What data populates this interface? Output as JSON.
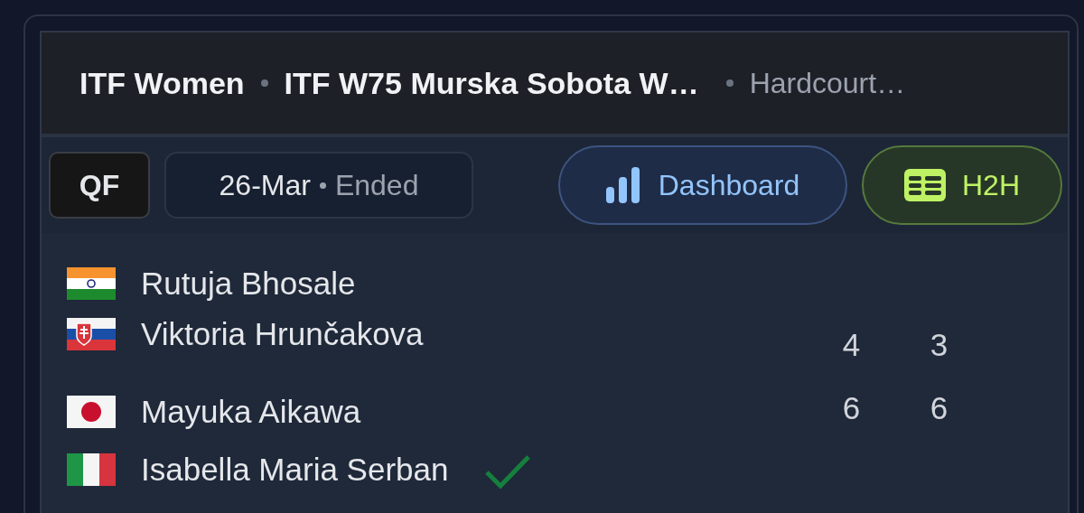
{
  "header": {
    "category": "ITF Women",
    "tournament": "ITF W75 Murska Sobota W…",
    "surface": "Hardcourt…"
  },
  "round": "QF",
  "date": "26-Mar",
  "status": "Ended",
  "buttons": [
    {
      "kind": "dashboard",
      "label": "Dashboard"
    },
    {
      "kind": "h2h",
      "label": "H2H"
    }
  ],
  "teams": [
    {
      "winner": false,
      "scores": [
        "4",
        "3"
      ],
      "players": [
        {
          "name": "Rutuja Bhosale",
          "kind": "india"
        },
        {
          "name": "Viktoria Hrunčakova",
          "kind": "slovakia"
        }
      ]
    },
    {
      "winner": true,
      "scores": [
        "6",
        "6"
      ],
      "players": [
        {
          "name": "Mayuka Aikawa",
          "kind": "japan"
        },
        {
          "name": "Isabella Maria Serban",
          "kind": "italy"
        }
      ]
    }
  ]
}
